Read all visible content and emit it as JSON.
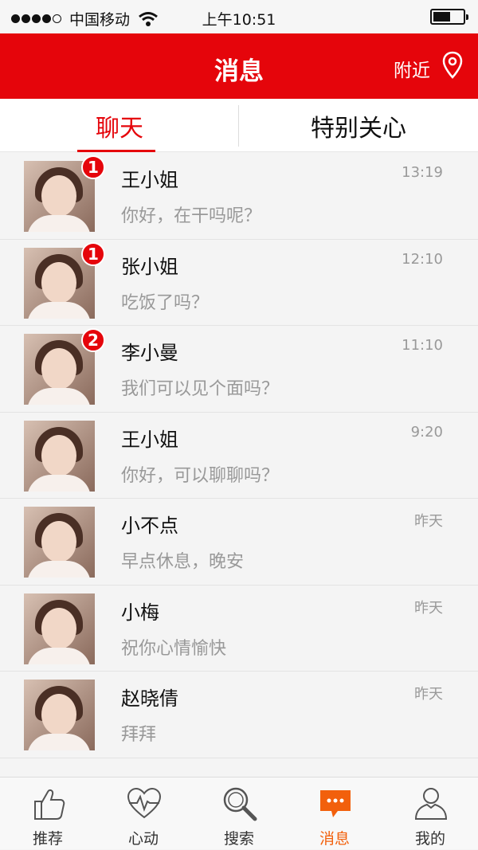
{
  "status_bar": {
    "carrier": "中国移动",
    "time": "上午10:51",
    "battery_level": 0.58,
    "signal_strength": 4
  },
  "nav": {
    "title": "消息",
    "nearby_label": "附近",
    "bar_color": "#e5050b"
  },
  "tabs": {
    "chat_label": "聊天",
    "special_label": "特别关心",
    "active": "聊天",
    "accent_color": "#e5050b"
  },
  "messages": [
    {
      "name": "王小姐",
      "preview": "你好，在干吗呢？",
      "time": "13:19",
      "badge": "1"
    },
    {
      "name": "张小姐",
      "preview": "吃饭了吗？",
      "time": "12:10",
      "badge": "1"
    },
    {
      "name": "李小曼",
      "preview": "我们可以见个面吗？",
      "time": "11:10",
      "badge": "2"
    },
    {
      "name": "王小姐",
      "preview": "你好，可以聊聊吗？",
      "time": "9:20",
      "badge": ""
    },
    {
      "name": "小不点",
      "preview": "早点休息，晚安",
      "time": "昨天",
      "badge": ""
    },
    {
      "name": "小梅",
      "preview": "祝你心情愉快",
      "time": "昨天",
      "badge": ""
    },
    {
      "name": "赵晓倩",
      "preview": "拜拜",
      "time": "昨天",
      "badge": ""
    }
  ],
  "bottom_nav": {
    "items": [
      {
        "label": "推荐",
        "icon": "thumbs-up-icon"
      },
      {
        "label": "心动",
        "icon": "heartbeat-icon"
      },
      {
        "label": "搜索",
        "icon": "search-icon"
      },
      {
        "label": "消息",
        "icon": "chat-bubble-icon"
      },
      {
        "label": "我的",
        "icon": "user-icon"
      }
    ],
    "active": "消息",
    "active_color": "#f2600c"
  }
}
